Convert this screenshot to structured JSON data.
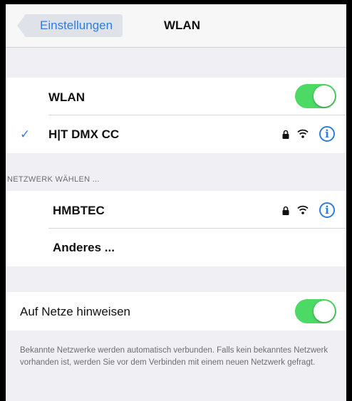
{
  "navbar": {
    "back_label": "Einstellungen",
    "title": "WLAN"
  },
  "wifi_group": {
    "wlan_label": "WLAN",
    "wlan_toggle_on": true,
    "connected_network": "H|T DMX CC",
    "check_glyph": "✓"
  },
  "network_section": {
    "header": "NETZWERK WÄHLEN ...",
    "networks": [
      {
        "name": "HMBTEC",
        "secured": true
      },
      {
        "name": "Anderes ..."
      }
    ]
  },
  "notify_group": {
    "label": "Auf Netze hinweisen",
    "toggle_on": true,
    "footer": "Bekannte Netzwerke werden automatisch verbunden. Falls kein bekanntes Netzwerk vorhanden ist, werden Sie vor dem Verbinden mit einem neuen Netzwerk gefragt."
  },
  "colors": {
    "accent": "#2e7de1",
    "toggle_on": "#4cd964",
    "background": "#efeff4"
  },
  "icons": {
    "lock": "lock-icon",
    "wifi": "wifi-icon",
    "info": "info-icon"
  },
  "info_glyph": "i"
}
